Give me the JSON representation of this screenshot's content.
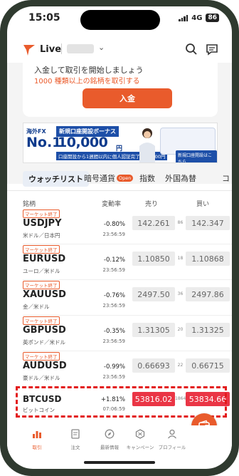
{
  "status": {
    "time": "15:05",
    "network": "4G",
    "battery": "86"
  },
  "header": {
    "account": "Live"
  },
  "promo": {
    "title": "入金して取引を開始しましょう",
    "subtitle": "1000 種類以上の銘柄を取引する",
    "deposit_button": "入金"
  },
  "ad": {
    "kaigai": "海外FX",
    "no1": "No.1",
    "headline": "新規口座開設ボーナス",
    "amount": "10,000",
    "yen": "円",
    "note": "口座開設から1週間以内に個人認証完了で15,000円",
    "cta": "新規口座開設はこちら"
  },
  "tabs": [
    {
      "label": "ウォッチリスト"
    },
    {
      "label": "暗号通貨",
      "badge": "Open"
    },
    {
      "label": "指数"
    },
    {
      "label": "外国為替"
    },
    {
      "label": "コ"
    }
  ],
  "columns": {
    "symbol": "銘柄",
    "change": "変動率",
    "sell": "売り",
    "buy": "買い"
  },
  "rows": [
    {
      "badge": "マーケット終了",
      "symbol": "USDJPY",
      "name": "米ドル／日本円",
      "change": "-0.80%",
      "time": "23:56:59",
      "bid": "142.261",
      "spread": "86",
      "ask": "142.347"
    },
    {
      "badge": "マーケット終了",
      "symbol": "EURUSD",
      "name": "ユーロ／米ドル",
      "change": "-0.12%",
      "time": "23:56:59",
      "bid": "1.10850",
      "spread": "18",
      "ask": "1.10868"
    },
    {
      "badge": "マーケット終了",
      "symbol": "XAUUSD",
      "name": "金／米ドル",
      "change": "-0.76%",
      "time": "23:56:59",
      "bid": "2497.50",
      "spread": "36",
      "ask": "2497.86"
    },
    {
      "badge": "マーケット終了",
      "symbol": "GBPUSD",
      "name": "英ポンド／米ドル",
      "change": "-0.35%",
      "time": "23:56:59",
      "bid": "1.31305",
      "spread": "20",
      "ask": "1.31325"
    },
    {
      "badge": "マーケット終了",
      "symbol": "AUDUSD",
      "name": "豪ドル／米ドル",
      "change": "-0.99%",
      "time": "23:56:59",
      "bid": "0.66693",
      "spread": "22",
      "ask": "0.66715"
    },
    {
      "badge": "",
      "symbol": "BTCUSD",
      "name": "ビットコイン",
      "change": "+1.81%",
      "time": "07:06:59",
      "bid": "53816.02",
      "spread": "1864",
      "ask": "53834.66"
    }
  ],
  "nav": [
    {
      "label": "取引",
      "icon": "chart-bars-icon"
    },
    {
      "label": "注文",
      "icon": "document-icon"
    },
    {
      "label": "最新情報",
      "icon": "compass-icon"
    },
    {
      "label": "キャンペーン",
      "icon": "gift-icon"
    },
    {
      "label": "プロフィール",
      "icon": "person-icon"
    }
  ],
  "colors": {
    "accent": "#e95b2c",
    "price_highlight": "#ea3545",
    "annotation": "#e31b1b"
  }
}
